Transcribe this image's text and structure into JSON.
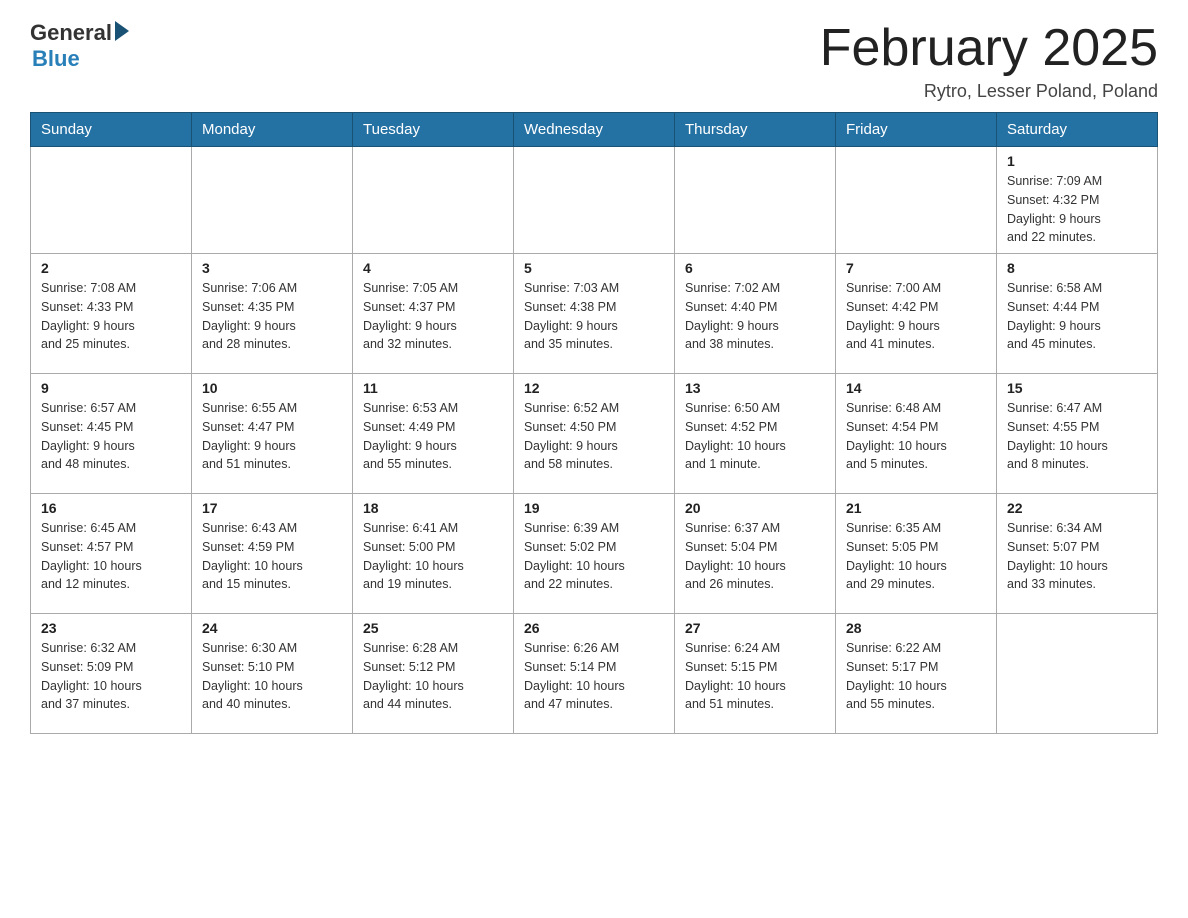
{
  "header": {
    "logo_general": "General",
    "logo_blue": "Blue",
    "month_title": "February 2025",
    "subtitle": "Rytro, Lesser Poland, Poland"
  },
  "weekdays": [
    "Sunday",
    "Monday",
    "Tuesday",
    "Wednesday",
    "Thursday",
    "Friday",
    "Saturday"
  ],
  "weeks": [
    {
      "days": [
        {
          "num": "",
          "info": ""
        },
        {
          "num": "",
          "info": ""
        },
        {
          "num": "",
          "info": ""
        },
        {
          "num": "",
          "info": ""
        },
        {
          "num": "",
          "info": ""
        },
        {
          "num": "",
          "info": ""
        },
        {
          "num": "1",
          "info": "Sunrise: 7:09 AM\nSunset: 4:32 PM\nDaylight: 9 hours\nand 22 minutes."
        }
      ]
    },
    {
      "days": [
        {
          "num": "2",
          "info": "Sunrise: 7:08 AM\nSunset: 4:33 PM\nDaylight: 9 hours\nand 25 minutes."
        },
        {
          "num": "3",
          "info": "Sunrise: 7:06 AM\nSunset: 4:35 PM\nDaylight: 9 hours\nand 28 minutes."
        },
        {
          "num": "4",
          "info": "Sunrise: 7:05 AM\nSunset: 4:37 PM\nDaylight: 9 hours\nand 32 minutes."
        },
        {
          "num": "5",
          "info": "Sunrise: 7:03 AM\nSunset: 4:38 PM\nDaylight: 9 hours\nand 35 minutes."
        },
        {
          "num": "6",
          "info": "Sunrise: 7:02 AM\nSunset: 4:40 PM\nDaylight: 9 hours\nand 38 minutes."
        },
        {
          "num": "7",
          "info": "Sunrise: 7:00 AM\nSunset: 4:42 PM\nDaylight: 9 hours\nand 41 minutes."
        },
        {
          "num": "8",
          "info": "Sunrise: 6:58 AM\nSunset: 4:44 PM\nDaylight: 9 hours\nand 45 minutes."
        }
      ]
    },
    {
      "days": [
        {
          "num": "9",
          "info": "Sunrise: 6:57 AM\nSunset: 4:45 PM\nDaylight: 9 hours\nand 48 minutes."
        },
        {
          "num": "10",
          "info": "Sunrise: 6:55 AM\nSunset: 4:47 PM\nDaylight: 9 hours\nand 51 minutes."
        },
        {
          "num": "11",
          "info": "Sunrise: 6:53 AM\nSunset: 4:49 PM\nDaylight: 9 hours\nand 55 minutes."
        },
        {
          "num": "12",
          "info": "Sunrise: 6:52 AM\nSunset: 4:50 PM\nDaylight: 9 hours\nand 58 minutes."
        },
        {
          "num": "13",
          "info": "Sunrise: 6:50 AM\nSunset: 4:52 PM\nDaylight: 10 hours\nand 1 minute."
        },
        {
          "num": "14",
          "info": "Sunrise: 6:48 AM\nSunset: 4:54 PM\nDaylight: 10 hours\nand 5 minutes."
        },
        {
          "num": "15",
          "info": "Sunrise: 6:47 AM\nSunset: 4:55 PM\nDaylight: 10 hours\nand 8 minutes."
        }
      ]
    },
    {
      "days": [
        {
          "num": "16",
          "info": "Sunrise: 6:45 AM\nSunset: 4:57 PM\nDaylight: 10 hours\nand 12 minutes."
        },
        {
          "num": "17",
          "info": "Sunrise: 6:43 AM\nSunset: 4:59 PM\nDaylight: 10 hours\nand 15 minutes."
        },
        {
          "num": "18",
          "info": "Sunrise: 6:41 AM\nSunset: 5:00 PM\nDaylight: 10 hours\nand 19 minutes."
        },
        {
          "num": "19",
          "info": "Sunrise: 6:39 AM\nSunset: 5:02 PM\nDaylight: 10 hours\nand 22 minutes."
        },
        {
          "num": "20",
          "info": "Sunrise: 6:37 AM\nSunset: 5:04 PM\nDaylight: 10 hours\nand 26 minutes."
        },
        {
          "num": "21",
          "info": "Sunrise: 6:35 AM\nSunset: 5:05 PM\nDaylight: 10 hours\nand 29 minutes."
        },
        {
          "num": "22",
          "info": "Sunrise: 6:34 AM\nSunset: 5:07 PM\nDaylight: 10 hours\nand 33 minutes."
        }
      ]
    },
    {
      "days": [
        {
          "num": "23",
          "info": "Sunrise: 6:32 AM\nSunset: 5:09 PM\nDaylight: 10 hours\nand 37 minutes."
        },
        {
          "num": "24",
          "info": "Sunrise: 6:30 AM\nSunset: 5:10 PM\nDaylight: 10 hours\nand 40 minutes."
        },
        {
          "num": "25",
          "info": "Sunrise: 6:28 AM\nSunset: 5:12 PM\nDaylight: 10 hours\nand 44 minutes."
        },
        {
          "num": "26",
          "info": "Sunrise: 6:26 AM\nSunset: 5:14 PM\nDaylight: 10 hours\nand 47 minutes."
        },
        {
          "num": "27",
          "info": "Sunrise: 6:24 AM\nSunset: 5:15 PM\nDaylight: 10 hours\nand 51 minutes."
        },
        {
          "num": "28",
          "info": "Sunrise: 6:22 AM\nSunset: 5:17 PM\nDaylight: 10 hours\nand 55 minutes."
        },
        {
          "num": "",
          "info": ""
        }
      ]
    }
  ]
}
